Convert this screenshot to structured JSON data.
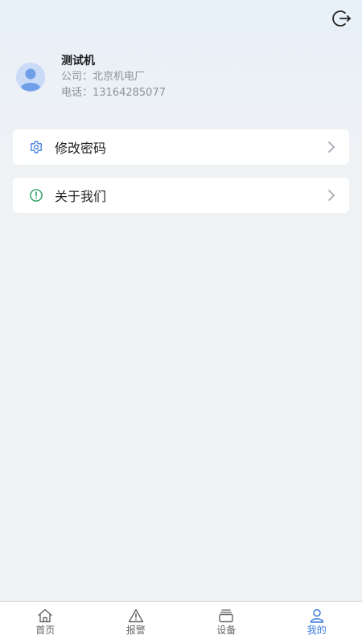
{
  "header": {
    "logout_icon": "logout-icon"
  },
  "profile": {
    "name": "测试机",
    "company": "公司：北京机电厂",
    "phone": "电话：13164285077",
    "avatar_icon": "user-avatar-icon"
  },
  "menu": [
    {
      "label": "修改密码",
      "icon": "gear-icon",
      "icon_color": "#2f6fd6"
    },
    {
      "label": "关于我们",
      "icon": "info-circle-icon",
      "icon_color": "#1f9a5b"
    }
  ],
  "tabbar": {
    "active_index": 3,
    "active_color": "#3a7bdc",
    "tabs": [
      {
        "label": "首页",
        "icon": "home-icon"
      },
      {
        "label": "报警",
        "icon": "alert-triangle-icon"
      },
      {
        "label": "设备",
        "icon": "device-stack-icon"
      },
      {
        "label": "我的",
        "icon": "user-icon"
      }
    ]
  }
}
